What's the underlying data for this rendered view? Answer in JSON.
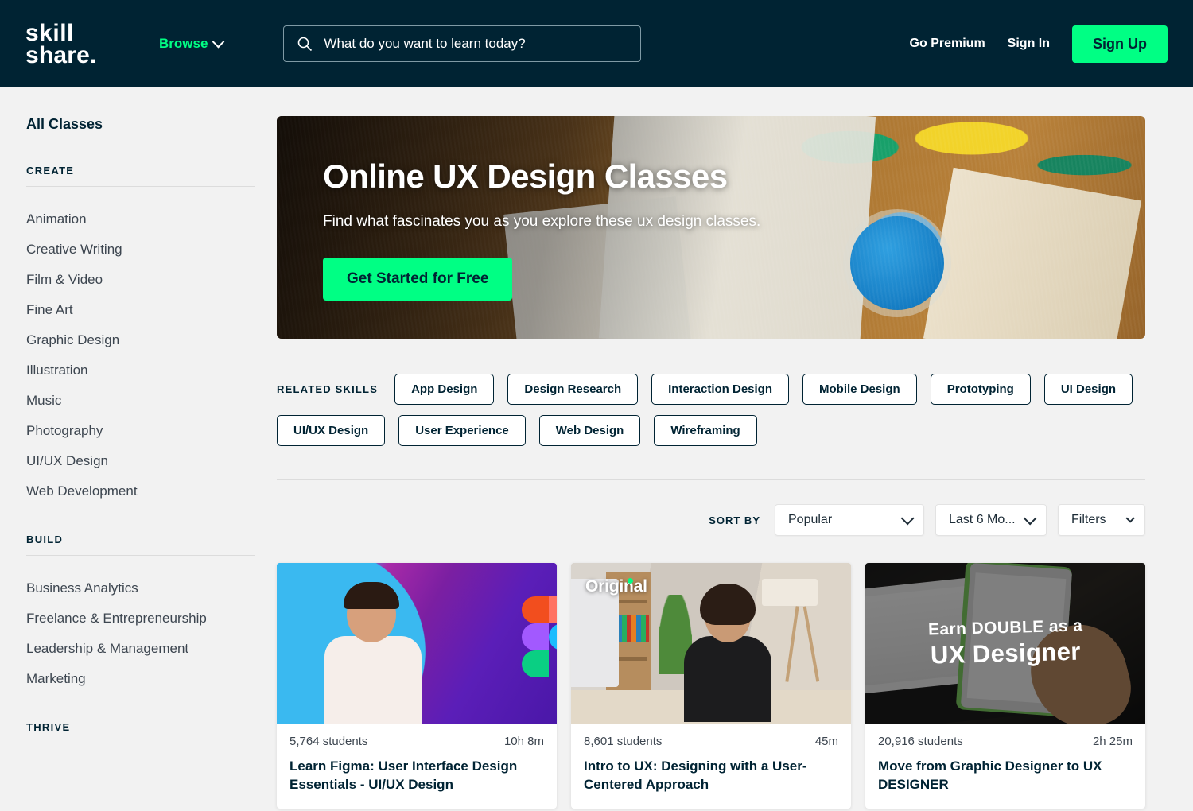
{
  "header": {
    "logo_line1": "skill",
    "logo_line2": "share.",
    "browse_label": "Browse",
    "search_placeholder": "What do you want to learn today?",
    "search_value": "",
    "go_premium": "Go Premium",
    "sign_in": "Sign In",
    "sign_up": "Sign Up",
    "bg_color": "#002333",
    "accent_color": "#00ff84"
  },
  "sidebar": {
    "all_classes": "All Classes",
    "sections": [
      {
        "title": "CREATE",
        "items": [
          "Animation",
          "Creative Writing",
          "Film & Video",
          "Fine Art",
          "Graphic Design",
          "Illustration",
          "Music",
          "Photography",
          "UI/UX Design",
          "Web Development"
        ]
      },
      {
        "title": "BUILD",
        "items": [
          "Business Analytics",
          "Freelance & Entrepreneurship",
          "Leadership & Management",
          "Marketing"
        ]
      },
      {
        "title": "THRIVE",
        "items": []
      }
    ]
  },
  "hero": {
    "title": "Online UX Design Classes",
    "subtitle": "Find what fascinates you as you explore these ux design classes.",
    "cta_label": "Get Started for Free"
  },
  "related_skills": {
    "label": "RELATED SKILLS",
    "chips": [
      "App Design",
      "Design Research",
      "Interaction Design",
      "Mobile Design",
      "Prototyping",
      "UI Design",
      "UI/UX Design",
      "User Experience",
      "Web Design",
      "Wireframing"
    ]
  },
  "sort": {
    "label": "SORT BY",
    "sort_value": "Popular",
    "time_value": "Last 6 Mo...",
    "filters_label": "Filters"
  },
  "cards": [
    {
      "students": "5,764 students",
      "duration": "10h 8m",
      "title": "Learn Figma: User Interface Design Essentials - UI/UX Design",
      "badge": ""
    },
    {
      "students": "8,601 students",
      "duration": "45m",
      "title": "Intro to UX: Designing with a User-Centered Approach",
      "badge": "Original"
    },
    {
      "students": "20,916 students",
      "duration": "2h 25m",
      "title": "Move from Graphic Designer to UX DESIGNER",
      "thumb_line1": "Earn DOUBLE as a",
      "thumb_line2": "UX Designer",
      "badge": ""
    }
  ]
}
